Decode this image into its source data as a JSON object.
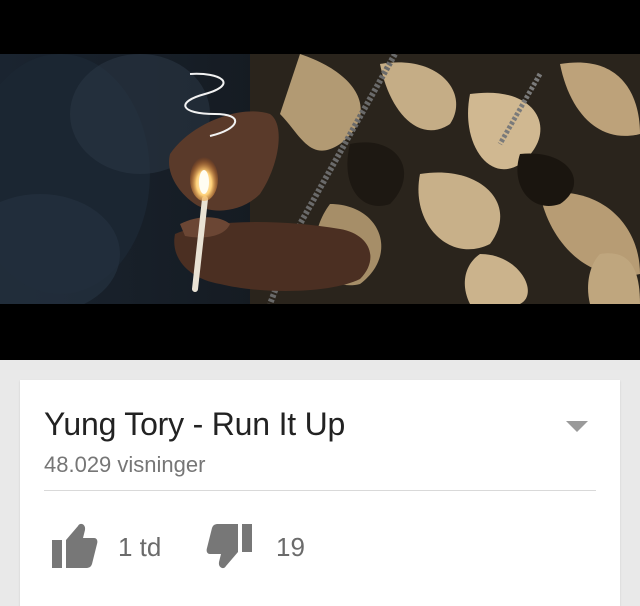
{
  "video": {
    "title": "Yung Tory - Run It Up",
    "views": "48.029 visninger",
    "likes": "1 td",
    "dislikes": "19"
  },
  "icons": {
    "like": "thumbs-up-icon",
    "dislike": "thumbs-down-icon",
    "expand": "chevron-down-icon"
  },
  "colors": {
    "title": "#222222",
    "meta": "#767676",
    "icon": "#777777",
    "background": "#e9e9e9"
  }
}
